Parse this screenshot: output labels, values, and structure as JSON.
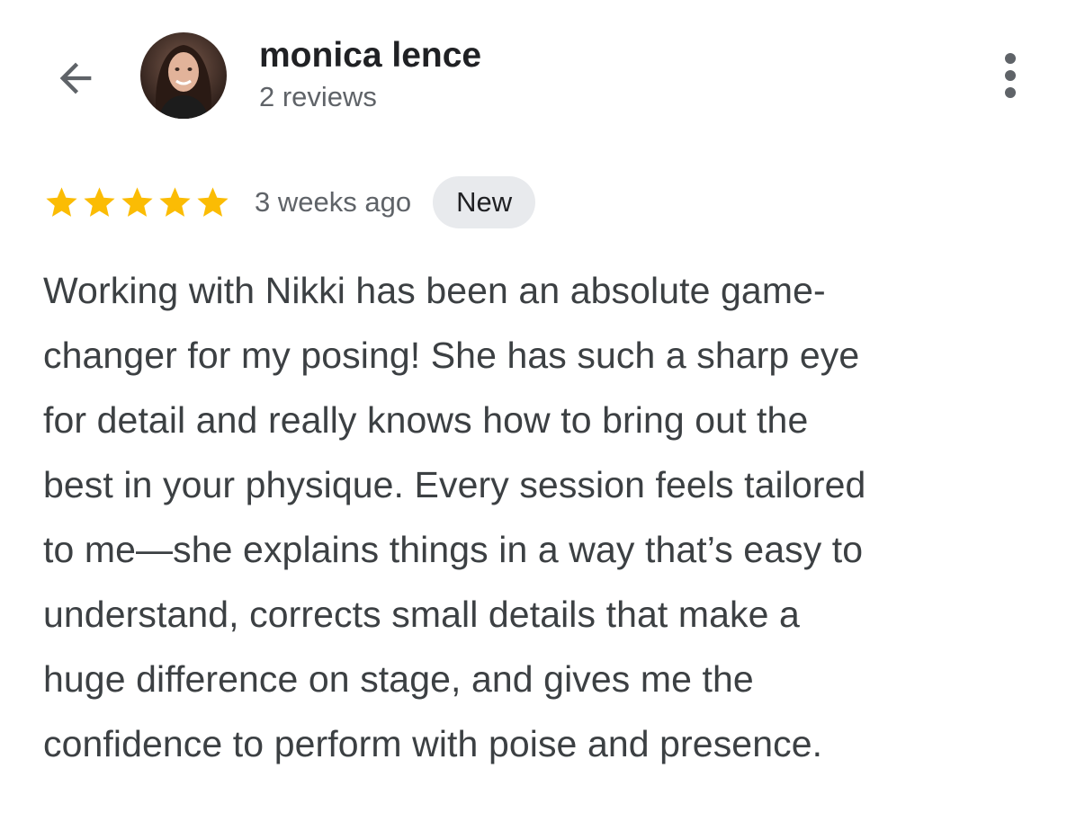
{
  "header": {
    "back_icon": "arrow-back-icon",
    "avatar_icon": "user-avatar",
    "reviewer_name": "monica lence",
    "reviewer_meta": "2 reviews",
    "more_icon": "more-vert-icon"
  },
  "review": {
    "rating": 5,
    "rating_max": 5,
    "star_color": "#fbbc04",
    "time": "3 weeks ago",
    "badge": "New",
    "lines": [
      "Working with Nikki has been an absolute game-",
      "changer for my posing! She has such a sharp eye",
      "for detail and really knows how to bring out the",
      "best in your physique. Every session feels tailored",
      "to me—she explains things in a way that’s easy to",
      "understand, corrects small details that make a",
      "huge difference on stage, and gives me the",
      "confidence to perform with poise and presence."
    ]
  }
}
